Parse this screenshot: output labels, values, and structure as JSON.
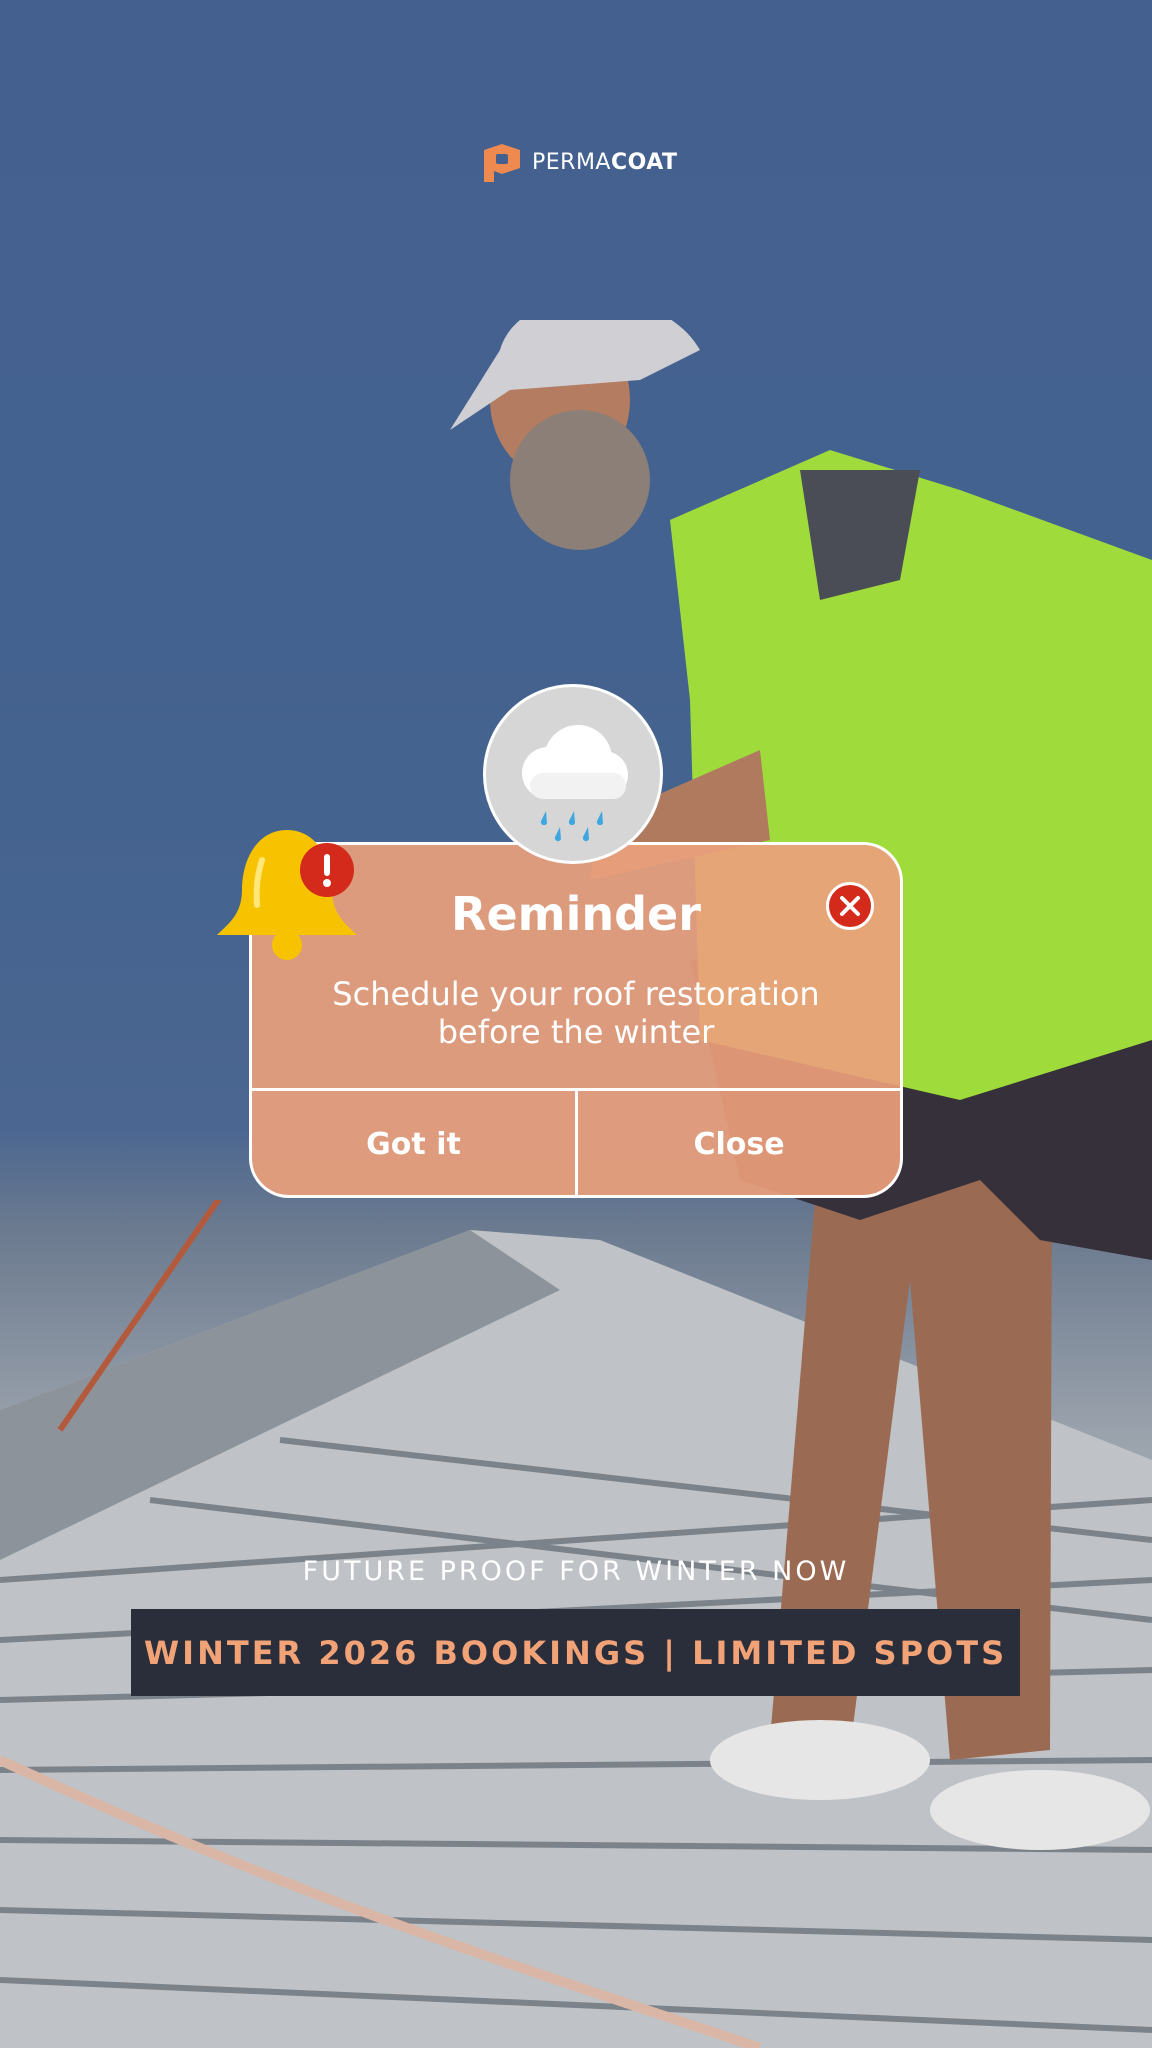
{
  "brand": {
    "logo_text_light": "PERMA",
    "logo_text_bold": "COAT",
    "accent": "#ee8a4f"
  },
  "dialog": {
    "icon": "rain-cloud-icon",
    "title": "Reminder",
    "message_line1": "Schedule your roof restoration",
    "message_line2": "before the winter",
    "primary_button": "Got it",
    "secondary_button": "Close",
    "bell_icon": "alert-bell-icon",
    "background": "#eaa07c"
  },
  "promo": {
    "tagline": "FUTURE PROOF FOR WINTER NOW",
    "banner": "WINTER 2026 BOOKINGS | LIMITED SPOTS",
    "banner_color": "#2a2d3a",
    "banner_text_color": "#f2a277"
  }
}
